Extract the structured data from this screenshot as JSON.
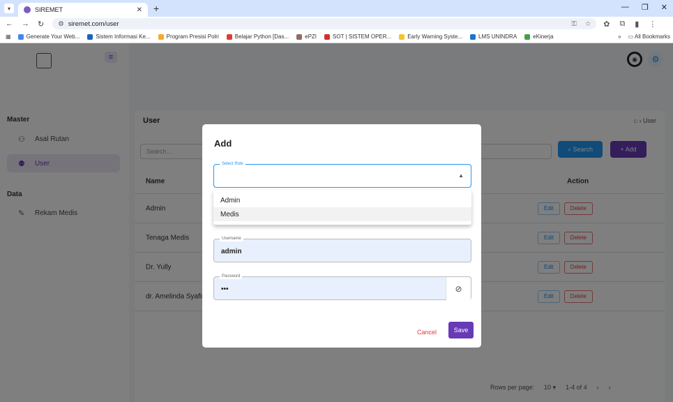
{
  "browser": {
    "tab_title": "SIREMET",
    "url": "siremet.com/user",
    "bookmarks": [
      "Generate Your Web...",
      "Sistem Informasi Ke...",
      "Program Presisi Polri",
      "Belajar Python [Das...",
      "ePZI",
      "SOT | SISTEM OPER...",
      "Early Warning Syste...",
      "LMS UNINDRA",
      "eKinerja"
    ],
    "all_bookmarks": "All Bookmarks"
  },
  "sidebar": {
    "section_master": "Master",
    "section_data": "Data",
    "items": [
      {
        "label": "Asal Rutan"
      },
      {
        "label": "User"
      },
      {
        "label": "Rekam Medis"
      }
    ]
  },
  "main": {
    "title": "User",
    "breadcrumb": "User",
    "search_placeholder": "Search...",
    "search_button": "Search",
    "add_button": "+ Add",
    "columns": {
      "name": "Name",
      "action": "Action"
    },
    "rows": [
      {
        "name": "Admin"
      },
      {
        "name": "Tenaga Medis"
      },
      {
        "name": "Dr. Yully"
      },
      {
        "name": "dr. Amelinda Syafira"
      }
    ],
    "edit_label": "Edit",
    "delete_label": "Delete",
    "rows_per_page_label": "Rows per page:",
    "rows_per_page": "10",
    "range": "1-4 of 4"
  },
  "modal": {
    "title": "Add",
    "role_label": "Select Role",
    "role_options": [
      "Admin",
      "Medis"
    ],
    "username_label": "Username",
    "username_value": "admin",
    "password_label": "Password",
    "password_value": "•••",
    "cancel": "Cancel",
    "save": "Save"
  }
}
